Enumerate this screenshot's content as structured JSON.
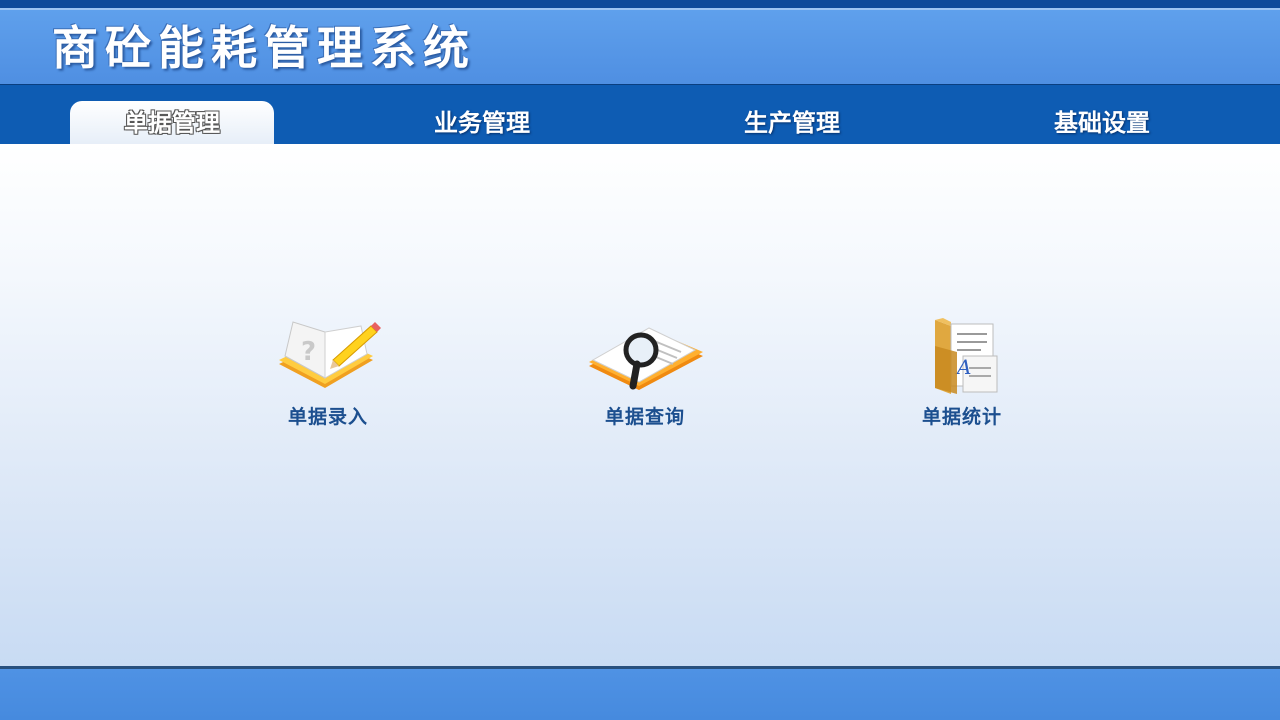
{
  "app": {
    "title": "商砼能耗管理系统"
  },
  "nav": {
    "tabs": [
      {
        "label": "单据管理",
        "active": true
      },
      {
        "label": "业务管理",
        "active": false
      },
      {
        "label": "生产管理",
        "active": false
      },
      {
        "label": "基础设置",
        "active": false
      }
    ]
  },
  "main": {
    "items": [
      {
        "label": "单据录入",
        "icon": "notebook-pencil-icon"
      },
      {
        "label": "单据查询",
        "icon": "magnifier-book-icon"
      },
      {
        "label": "单据统计",
        "icon": "folder-documents-icon"
      }
    ]
  },
  "colors": {
    "title_bar": "#5a9aea",
    "nav_bar": "#0e5cb3",
    "label_text": "#1c4f8f",
    "footer": "#4a8de0"
  }
}
